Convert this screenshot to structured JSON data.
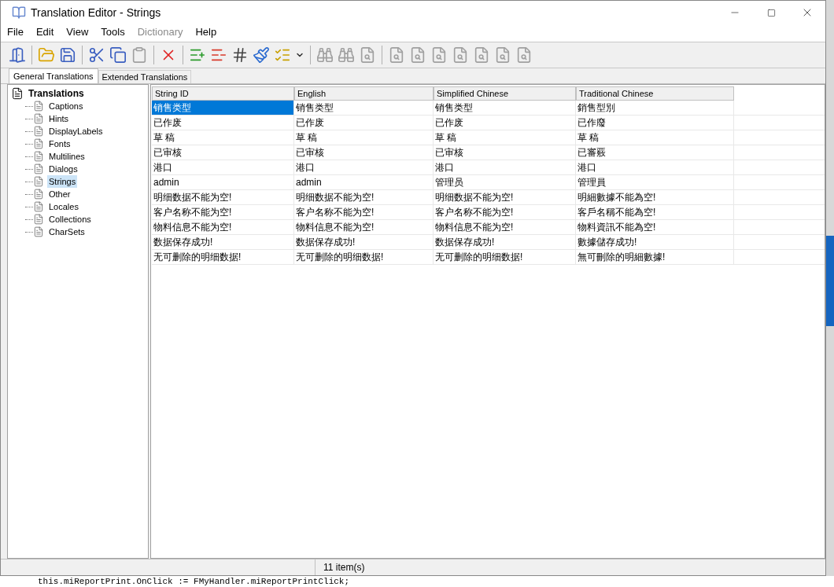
{
  "window": {
    "title": "Translation Editor - Strings"
  },
  "menu": [
    {
      "label": "File",
      "disabled": false
    },
    {
      "label": "Edit",
      "disabled": false
    },
    {
      "label": "View",
      "disabled": false
    },
    {
      "label": "Tools",
      "disabled": false
    },
    {
      "label": "Dictionary",
      "disabled": true
    },
    {
      "label": "Help",
      "disabled": false
    }
  ],
  "toolbar": [
    {
      "kind": "exit",
      "disabled": false
    },
    {
      "kind": "separator"
    },
    {
      "kind": "open",
      "disabled": false
    },
    {
      "kind": "save",
      "disabled": false
    },
    {
      "kind": "separator"
    },
    {
      "kind": "cut",
      "disabled": false
    },
    {
      "kind": "copy",
      "disabled": false
    },
    {
      "kind": "paste",
      "disabled": true
    },
    {
      "kind": "separator"
    },
    {
      "kind": "delete",
      "disabled": false
    },
    {
      "kind": "separator"
    },
    {
      "kind": "add",
      "disabled": false
    },
    {
      "kind": "remove",
      "disabled": false
    },
    {
      "kind": "find-id",
      "disabled": false
    },
    {
      "kind": "clear",
      "disabled": false
    },
    {
      "kind": "hint",
      "disabled": false
    },
    {
      "kind": "dropdown",
      "disabled": false
    },
    {
      "kind": "separator"
    },
    {
      "kind": "find",
      "disabled": true
    },
    {
      "kind": "find-next",
      "disabled": true
    },
    {
      "kind": "doc",
      "disabled": true
    },
    {
      "kind": "separator"
    },
    {
      "kind": "doc",
      "disabled": true
    },
    {
      "kind": "doc",
      "disabled": true
    },
    {
      "kind": "doc",
      "disabled": true
    },
    {
      "kind": "doc",
      "disabled": true
    },
    {
      "kind": "doc",
      "disabled": true
    },
    {
      "kind": "doc",
      "disabled": true
    },
    {
      "kind": "doc",
      "disabled": true
    }
  ],
  "tabs": [
    {
      "label": "General Translations",
      "selected": true
    },
    {
      "label": "Extended Translations",
      "selected": false
    }
  ],
  "tree": {
    "label": "Translations",
    "children": [
      {
        "label": "Captions",
        "selected": false
      },
      {
        "label": "Hints",
        "selected": false
      },
      {
        "label": "DisplayLabels",
        "selected": false
      },
      {
        "label": "Fonts",
        "selected": false
      },
      {
        "label": "Multilines",
        "selected": false
      },
      {
        "label": "Dialogs",
        "selected": false
      },
      {
        "label": "Strings",
        "selected": true
      },
      {
        "label": "Other",
        "selected": false
      },
      {
        "label": "Locales",
        "selected": false
      },
      {
        "label": "Collections",
        "selected": false
      },
      {
        "label": "CharSets",
        "selected": false
      }
    ]
  },
  "table": {
    "columns": [
      "String ID",
      "English",
      "Simplified Chinese",
      "Traditional Chinese"
    ],
    "rows": [
      {
        "selected": true,
        "cells": [
          "销售类型",
          "销售类型",
          "销售类型",
          "銷售型別"
        ]
      },
      {
        "selected": false,
        "cells": [
          "已作废",
          "已作废",
          "已作废",
          "已作廢"
        ]
      },
      {
        "selected": false,
        "cells": [
          "草 稿",
          "草 稿",
          "草 稿",
          "草 稿"
        ]
      },
      {
        "selected": false,
        "cells": [
          "已审核",
          "已审核",
          "已审核",
          "已審覈"
        ]
      },
      {
        "selected": false,
        "cells": [
          "港口",
          "港口",
          "港口",
          "港口"
        ]
      },
      {
        "selected": false,
        "cells": [
          "admin",
          "admin",
          "管理员",
          "管理員"
        ]
      },
      {
        "selected": false,
        "cells": [
          "明细数据不能为空!",
          "明细数据不能为空!",
          "明细数据不能为空!",
          "明細數據不能為空!"
        ]
      },
      {
        "selected": false,
        "cells": [
          "客户名称不能为空!",
          "客户名称不能为空!",
          "客户名称不能为空!",
          "客戶名稱不能為空!"
        ]
      },
      {
        "selected": false,
        "cells": [
          "物料信息不能为空!",
          "物料信息不能为空!",
          "物料信息不能为空!",
          "物料資訊不能為空!"
        ]
      },
      {
        "selected": false,
        "cells": [
          "数据保存成功!",
          "数据保存成功!",
          "数据保存成功!",
          "數據儲存成功!"
        ]
      },
      {
        "selected": false,
        "cells": [
          "无可删除的明细数据!",
          "无可删除的明细数据!",
          "无可删除的明细数据!",
          "無可刪除的明細數據!"
        ]
      }
    ]
  },
  "status_bar": "11 item(s)",
  "background_code": "this.miReportPrint.OnClick := FMyHandler.miReportPrintClick;"
}
